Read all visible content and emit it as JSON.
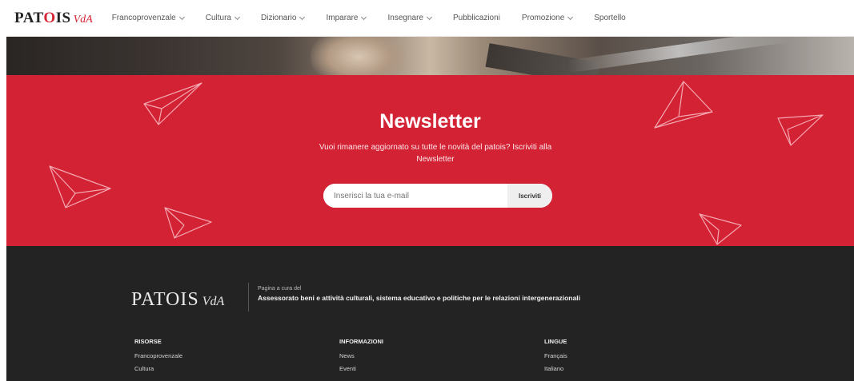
{
  "header": {
    "logo_main": "PAT",
    "logo_o": "O",
    "logo_rest": "IS",
    "logo_sub": "VdA",
    "nav": [
      {
        "label": "Francoprovenzale",
        "dropdown": true
      },
      {
        "label": "Cultura",
        "dropdown": true
      },
      {
        "label": "Dizionario",
        "dropdown": true
      },
      {
        "label": "Imparare",
        "dropdown": true
      },
      {
        "label": "Insegnare",
        "dropdown": true
      },
      {
        "label": "Pubblicazioni",
        "dropdown": false
      },
      {
        "label": "Promozione",
        "dropdown": true
      },
      {
        "label": "Sportello",
        "dropdown": false
      }
    ]
  },
  "newsletter": {
    "title": "Newsletter",
    "subtitle": "Vuoi rimanere aggiornato su tutte le novità del patois? Iscriviti alla Newsletter",
    "input_placeholder": "Inserisci la tua e-mail",
    "button_label": "Iscriviti"
  },
  "footer": {
    "logo_main": "PATOIS",
    "logo_sub": "VdA",
    "curated_by": "Pagina a cura del",
    "organization": "Assessorato beni e attività culturali, sistema educativo e politiche per le relazioni intergenerazionali",
    "columns": [
      {
        "title": "RISORSE",
        "links": [
          "Francoprovenzale",
          "Cultura"
        ]
      },
      {
        "title": "INFORMAZIONI",
        "links": [
          "News",
          "Eventi"
        ]
      },
      {
        "title": "LINGUE",
        "links": [
          "Français",
          "Italiano"
        ]
      }
    ]
  },
  "colors": {
    "accent_red": "#d42235",
    "footer_bg": "#232323",
    "navbar_bg": "#ffffff"
  }
}
